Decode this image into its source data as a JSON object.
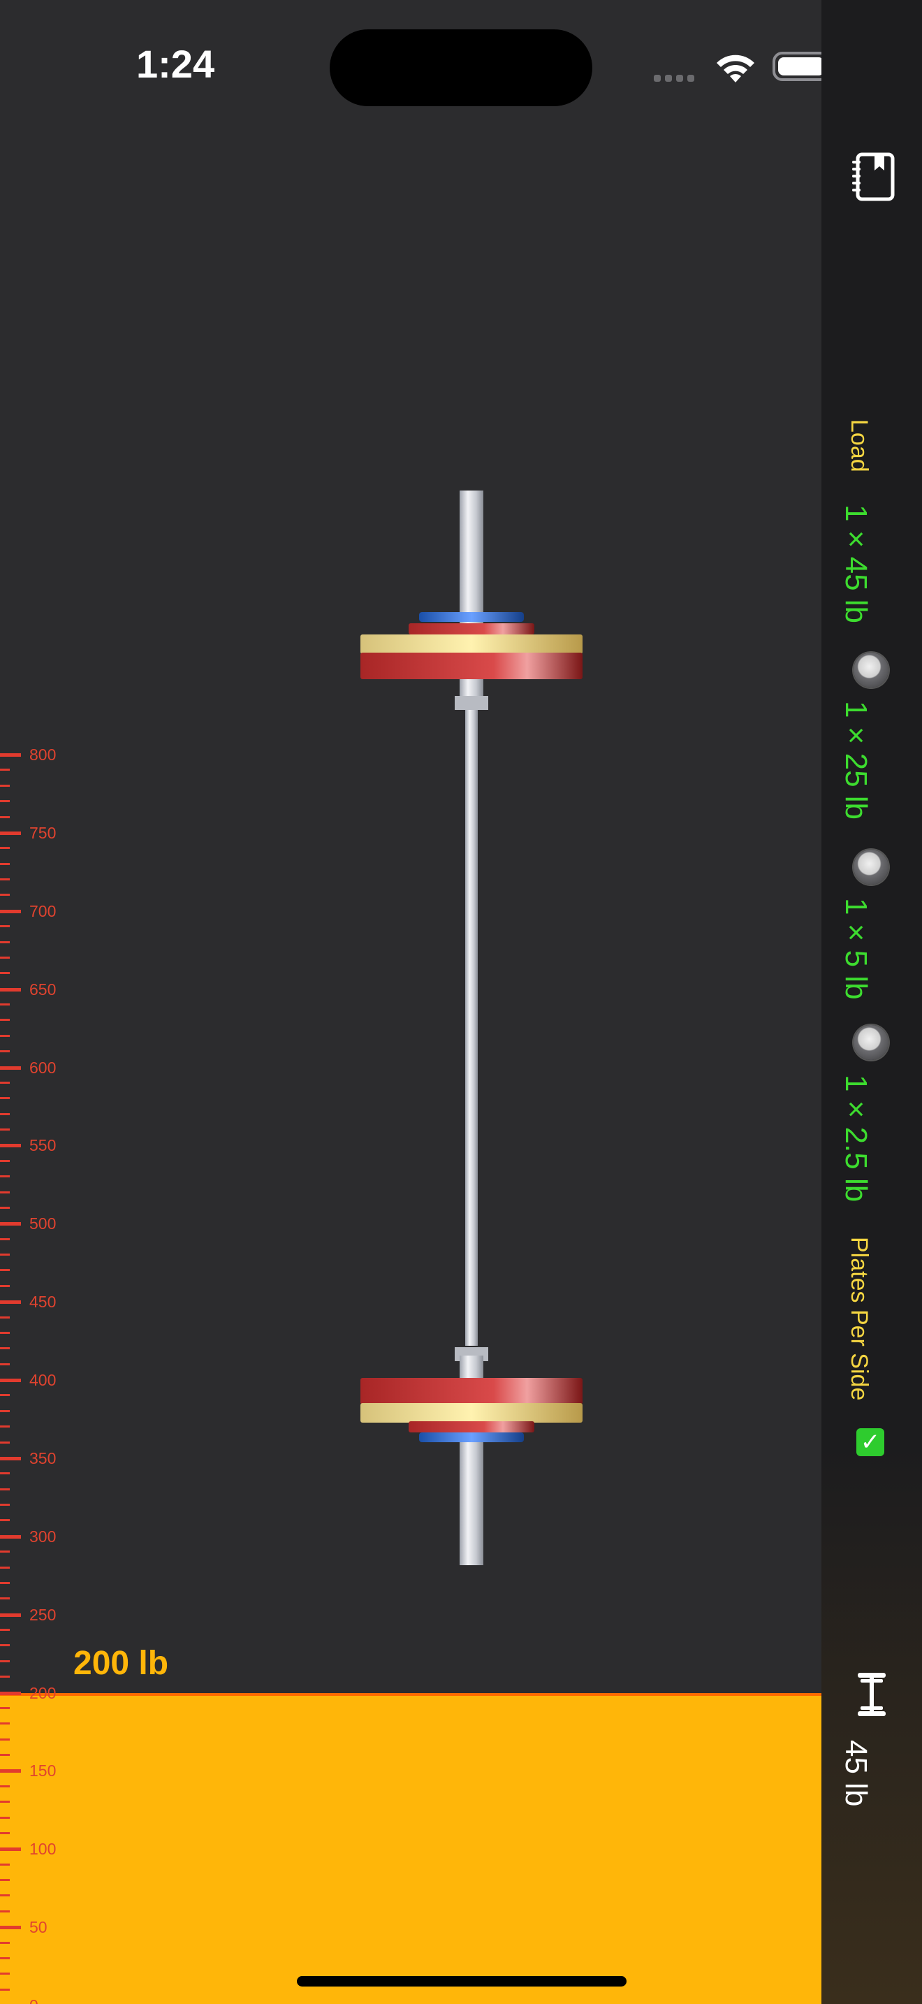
{
  "status_bar": {
    "time": "1:24"
  },
  "scale": {
    "unit": "lb",
    "min": 0,
    "max": 800,
    "major_step": 50,
    "labels": [
      "0",
      "50",
      "100",
      "150",
      "200",
      "250",
      "300",
      "350",
      "400",
      "450",
      "500",
      "550",
      "600",
      "650",
      "700",
      "750",
      "800"
    ]
  },
  "current": {
    "weight_value": 200,
    "weight_label": "200 lb"
  },
  "sidebar": {
    "load_label": "Load",
    "plates": [
      {
        "label": "1 × 45 lb"
      },
      {
        "label": "1 × 25 lb"
      },
      {
        "label": "1 × 5 lb"
      },
      {
        "label": "1 × 2.5 lb"
      }
    ],
    "plates_per_side_label": "Plates Per Side",
    "plates_per_side_checked": true,
    "bar_weight_label": "45 lb"
  },
  "colors": {
    "fill": "#ffb609",
    "ruler": "#e0432f",
    "plate_text": "#3ddc2f",
    "label_yellow": "#f5d642"
  },
  "icons": [
    "logbook-icon",
    "barbell-icon",
    "wifi-icon",
    "battery-icon",
    "checkmark-icon"
  ]
}
